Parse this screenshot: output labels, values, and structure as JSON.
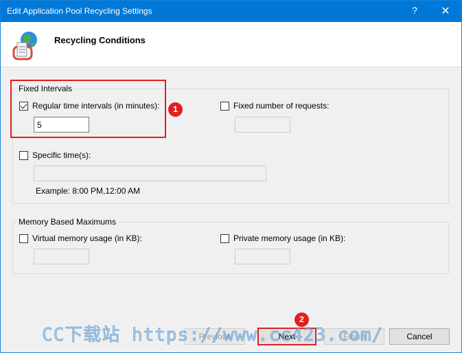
{
  "window": {
    "title": "Edit Application Pool Recycling Settings",
    "help_glyph": "?",
    "close_glyph": "✕"
  },
  "header": {
    "heading": "Recycling Conditions",
    "icon": "recycling-globe-icon"
  },
  "fixed_intervals": {
    "group_label": "Fixed Intervals",
    "regular_time": {
      "label": "Regular time intervals (in minutes):",
      "checked": true,
      "value": "5"
    },
    "fixed_requests": {
      "label": "Fixed number of requests:",
      "checked": false,
      "value": ""
    },
    "specific_times": {
      "label": "Specific time(s):",
      "checked": false,
      "value": ""
    },
    "example": "Example: 8:00 PM,12:00 AM"
  },
  "memory": {
    "group_label": "Memory Based Maximums",
    "virtual": {
      "label": "Virtual memory usage (in KB):",
      "checked": false,
      "value": ""
    },
    "private": {
      "label": "Private memory usage (in KB):",
      "checked": false,
      "value": ""
    }
  },
  "annotations": {
    "marker_1": "1",
    "marker_2": "2"
  },
  "buttons": {
    "previous": "Previous",
    "next": "Next",
    "finish": "Finish",
    "cancel": "Cancel"
  },
  "watermark": "CC下载站 https://www.cc423.com/",
  "colors": {
    "titlebar": "#0078d7",
    "annotation_red": "#e02020"
  }
}
